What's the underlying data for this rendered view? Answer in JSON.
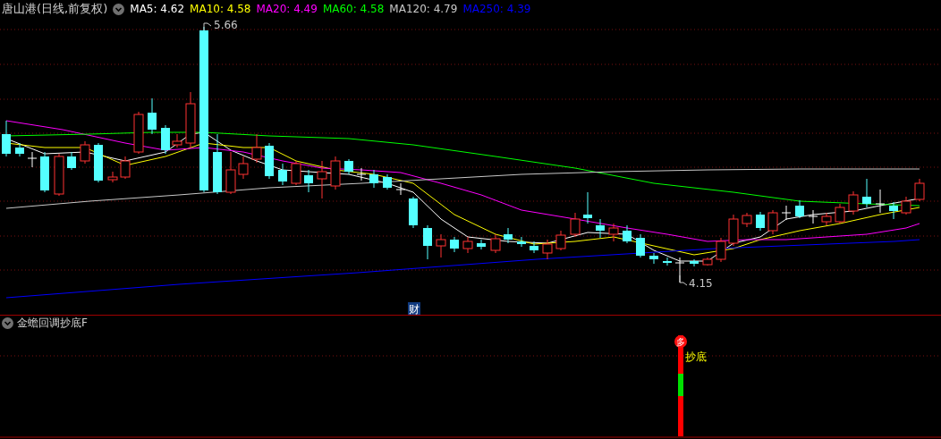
{
  "chart": {
    "title": "唐山港(日线,前复权)",
    "ma_legend": [
      {
        "text": "MA5: 4.62",
        "color": "#ffffff"
      },
      {
        "text": "MA10: 4.58",
        "color": "#ffff00"
      },
      {
        "text": "MA20: 4.49",
        "color": "#ff00ff"
      },
      {
        "text": "MA60: 4.58",
        "color": "#00ff00"
      },
      {
        "text": "MA120: 4.79",
        "color": "#c8c8c8"
      },
      {
        "text": "MA250: 4.39",
        "color": "#0000ff"
      }
    ],
    "high_label": "5.66",
    "low_label": "4.15",
    "event_marker": "财"
  },
  "indicator": {
    "title": "金蟾回调抄底F",
    "signal_badge": "多",
    "signal_label": "抄底"
  }
}
